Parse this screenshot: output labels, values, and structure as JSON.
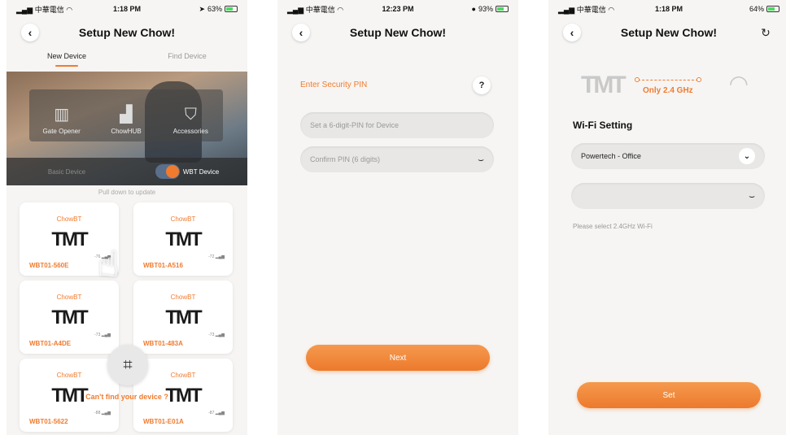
{
  "colors": {
    "accent": "#f07b2e",
    "background": "#f6f5f3",
    "text": "#222222"
  },
  "panel1": {
    "status": {
      "carrier": "中華電信",
      "time": "1:18 PM",
      "battery": "63%"
    },
    "title": "Setup New Chow!",
    "tabs": [
      "New Device",
      "Find Device"
    ],
    "accessories": [
      {
        "label": "Gate Opener",
        "icon": "gate-icon"
      },
      {
        "label": "ChowHUB",
        "icon": "hub-icon"
      },
      {
        "label": "Accessories",
        "icon": "shield-icon"
      }
    ],
    "modes": {
      "basic": "Basic Device",
      "wbt": "WBT Device"
    },
    "pull_hint": "Pull down to update",
    "devices": [
      {
        "brand": "ChowBT",
        "name": "WBT01-560E",
        "signal": "-76"
      },
      {
        "brand": "ChowBT",
        "name": "WBT01-A516",
        "signal": "-72"
      },
      {
        "brand": "ChowBT",
        "name": "WBT01-A4DE",
        "signal": "-73"
      },
      {
        "brand": "ChowBT",
        "name": "WBT01-483A",
        "signal": "-73"
      },
      {
        "brand": "ChowBT",
        "name": "WBT01-5622",
        "signal": "-88"
      },
      {
        "brand": "ChowBT",
        "name": "WBT01-E01A",
        "signal": "-87"
      }
    ],
    "logo_text": "TMT",
    "cant_find": "Can't find your device ?"
  },
  "panel2": {
    "status": {
      "carrier": "中華電信",
      "time": "12:23 PM",
      "battery": "93%"
    },
    "title": "Setup New Chow!",
    "pin_title": "Enter Security PIN",
    "help": "?",
    "pin_placeholder": "Set a 6-digit-PIN for Device",
    "confirm_placeholder": "Confirm PIN (6 digits)",
    "next_label": "Next"
  },
  "panel3": {
    "status": {
      "carrier": "中華電信",
      "time": "1:18 PM",
      "battery": "64%"
    },
    "title": "Setup New Chow!",
    "logo_text": "TMT",
    "only_ghz": "Only 2.4 GHz",
    "section_title": "Wi-Fi Setting",
    "wifi_selected": "Powertech - Office",
    "password_value": "",
    "hint": "Please select 2.4GHz Wi-Fi",
    "set_label": "Set"
  }
}
